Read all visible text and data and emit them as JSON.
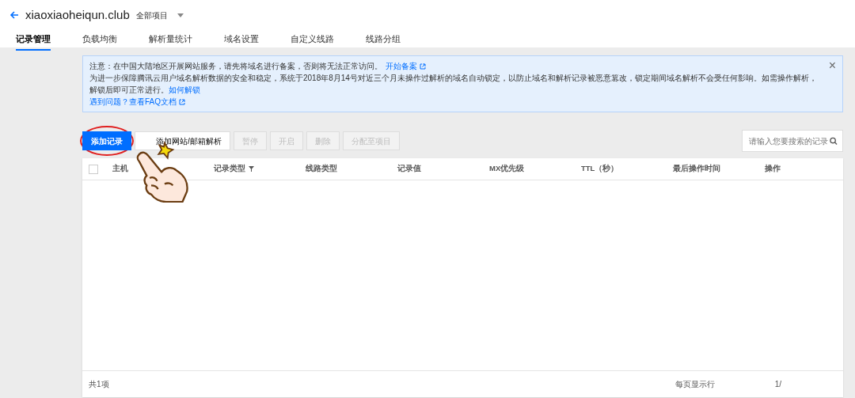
{
  "header": {
    "domain": "xiaoxiaoheiqun.club",
    "project": "全部项目"
  },
  "tabs": [
    {
      "label": "记录管理",
      "selected": true
    },
    {
      "label": "负载均衡",
      "selected": false
    },
    {
      "label": "解析量统计",
      "selected": false
    },
    {
      "label": "域名设置",
      "selected": false
    },
    {
      "label": "自定义线路",
      "selected": false
    },
    {
      "label": "线路分组",
      "selected": false
    }
  ],
  "notice": {
    "close": "×",
    "line1": "注意：在中国大陆地区开展网站服务，请先将域名进行备案，否则将无法正常访问。",
    "link1": "开始备案",
    "line2": "为进一步保障腾讯云用户域名解析数据的安全和稳定，系统于2018年8月14号对近三个月未操作过解析的域名自动锁定，以防止域名和解析记录被恶意篡改，锁定期间域名解析不会受任何影响。如需操作解析，解锁后即可正常进行。",
    "link2": "如何解锁",
    "link3": "遇到问题？查看FAQ文档"
  },
  "toolbar": [
    {
      "label": "添加记录",
      "kind": "primary",
      "disabled": false
    },
    {
      "label": "添加网站/邮箱解析",
      "kind": "default",
      "disabled": false
    },
    {
      "label": "暂停",
      "kind": "default",
      "disabled": true
    },
    {
      "label": "开启",
      "kind": "default",
      "disabled": true
    },
    {
      "label": "删除",
      "kind": "default",
      "disabled": true
    },
    {
      "label": "分配至项目",
      "kind": "default",
      "disabled": true
    }
  ],
  "search": {
    "placeholder": "请输入您要搜索的记录"
  },
  "table": {
    "select_all": {
      "checked": false
    },
    "columns": [
      {
        "label": "主机",
        "filter": false
      },
      {
        "label": "记录类型",
        "filter": true
      },
      {
        "label": "线路类型",
        "filter": false
      },
      {
        "label": "记录值",
        "filter": false
      },
      {
        "label": "MX优先级",
        "filter": false
      },
      {
        "label": "TTL（秒）",
        "filter": false
      },
      {
        "label": "最后操作时间",
        "filter": false
      },
      {
        "label": "操作",
        "filter": false
      }
    ]
  },
  "footer": {
    "total": "共1项",
    "per_page_label": "每页显示行",
    "page": "1/"
  }
}
